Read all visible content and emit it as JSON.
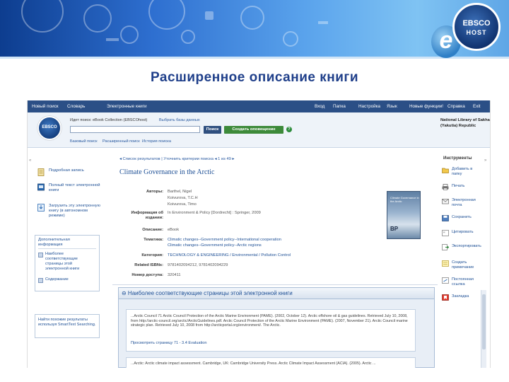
{
  "brand": {
    "logo_top": "EBSCO",
    "logo_bottom": "HOST",
    "e_mark": "e"
  },
  "slide_title": "Расширенное описание книги",
  "topnav": {
    "left": [
      "Новый поиск",
      "Словарь",
      "Электронные книги"
    ],
    "right": [
      "Вход",
      "Папка",
      "Настройка",
      "Язык",
      "Новые функции!",
      "Справка",
      "Exit"
    ]
  },
  "search": {
    "search_in_label": "Идет поиск: eBook Collection (EBSCOhost)",
    "choose_db": "Выбрать базы данных",
    "search_button": "Поиск",
    "alert_button": "Создать оповещение",
    "help": "?",
    "links": [
      "Базовый поиск",
      "Расширенный поиск",
      "История поиска"
    ],
    "library": [
      "National Library of Sakha",
      "(Yakutia) Republic"
    ],
    "logo": "EBSCO"
  },
  "left": {
    "items": [
      {
        "label": "Подробная запись"
      },
      {
        "label": "Полный текст электронной книги"
      },
      {
        "label": "Загрузить эту электронную книгу (в автономном режиме)"
      }
    ],
    "box_head": "Дополнительная информация",
    "box_items": [
      "Наиболее соответствующие страницы этой электронной книги",
      "Содержание"
    ],
    "smart": "Найти похожие результаты используя SmartText Searching."
  },
  "record": {
    "results_nav": "◂ Список результатов | Уточнить критерии поиска ◂ 1 из 49 ▸",
    "title": "Climate Governance in the Arctic",
    "fields": [
      {
        "label": "Авторы:",
        "values": [
          "Barthel, Nigel",
          "Koivurova, T.C.H",
          "Koivurova, Timo"
        ],
        "link": false
      },
      {
        "label": "Информация об издании:",
        "values": [
          "In Environment & Policy [Dordrecht] : Springer, 2009"
        ],
        "link": false
      },
      {
        "label": "Описание:",
        "values": [
          "eBook"
        ],
        "link": false
      },
      {
        "label": "Тематика:",
        "values": [
          "Climatic changes--Government policy--International cooperation",
          "Climatic changes--Government policy--Arctic regions"
        ],
        "link": true
      },
      {
        "label": "Категория:",
        "values": [
          "TECHNOLOGY & ENGINEERING / Environmental / Pollution Control"
        ],
        "link": true
      },
      {
        "label": "Related ISBNs:",
        "values": [
          "9781402094212, 9781402094229"
        ],
        "link": false
      },
      {
        "label": "Номер доступа:",
        "values": [
          "320411"
        ],
        "link": false
      }
    ],
    "cover": {
      "title": "Climate Governance in the Arctic",
      "bp": "BP"
    }
  },
  "panel": {
    "head": "⊖ Наиболее соответствующие страницы этой электронной книги",
    "card1_text": "...Arctic Council 71 Arctic Council Protection of the Arctic Marine Environment (PAME). (2002, October 12). Arctic offshore oil & gas guidelines. Retrieved July 10, 2008, from http://arctic-council.org/arctic/ArcticGuidelines.pdf. Arctic Council Protection of the Arctic Marine Environment (PAME). (2007, November 21). Arctic Council marine strategic plan. Retrieved July 10, 2008 from http://arcticportal.org/environment/. The Arctic.",
    "card1_link": "Просмотреть страницу 71 - 3.4 Evaluation",
    "card2_text": "...Arctic: Arctic climate impact assessment. Cambridge, UK: Cambridge University Press. Arctic Climate Impact Assessment (ACIA). (2005). Arctic ..."
  },
  "tools": {
    "head": "Инструменты",
    "items": [
      "Добавить в папку",
      "Печать",
      "Электронная почта",
      "Сохранить",
      "Цитировать",
      "Экспортировать",
      "Создать примечание",
      "Постоянная ссылка",
      "Закладка"
    ]
  }
}
